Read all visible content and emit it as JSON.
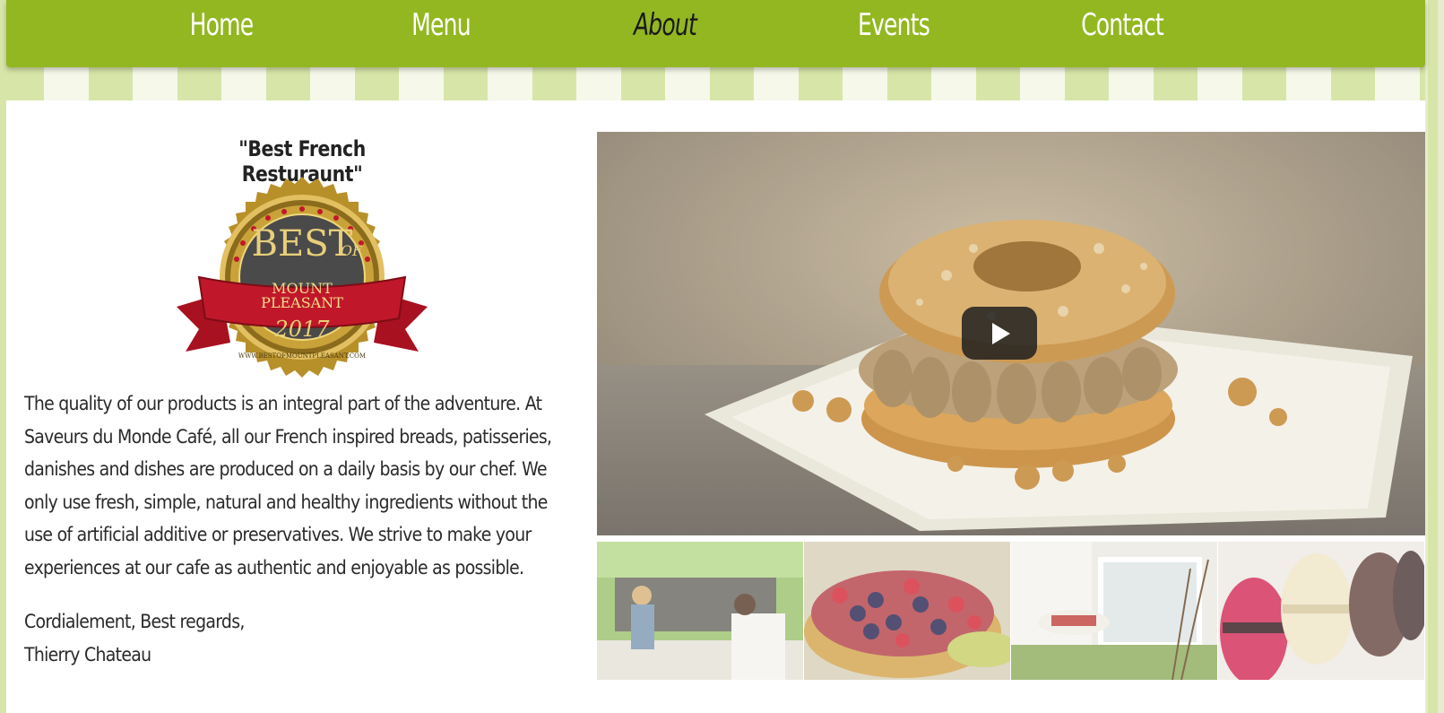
{
  "nav": {
    "items": [
      {
        "label": "Home"
      },
      {
        "label": "Menu"
      },
      {
        "label": "About"
      },
      {
        "label": "Events"
      },
      {
        "label": "Contact"
      }
    ],
    "active": "About"
  },
  "award": {
    "title": "\"Best French Resturaunt\"",
    "badge": {
      "line1": "BEST",
      "line1b": "OF",
      "line2": "MOUNT",
      "line3": "PLEASANT",
      "year": "2017",
      "url": "WWW.BESTOFMOUNTPLEASANT.COM"
    }
  },
  "about": {
    "paragraph": "The quality of our products is an integral part of the adventure. At Saveurs du Monde Café, all our French inspired breads, patisseries, danishes and dishes are produced on a daily basis by our chef. We only use fresh, simple, natural and healthy ingredients without the use of artificial additive or preservatives. We strive to make your experiences at our cafe as authentic and enjoyable as possible.",
    "signoff": "Cordialement, Best regards,",
    "signature": "Thierry Chateau"
  },
  "video": {
    "subject": "paris-brest-pastry",
    "icon": "play-icon"
  },
  "thumbnails": [
    {
      "subject": "cafe-counter"
    },
    {
      "subject": "berry-tart"
    },
    {
      "subject": "cafe-window-table"
    },
    {
      "subject": "macarons"
    }
  ],
  "colors": {
    "nav_green": "#93b721",
    "stripe_light": "#d7e6a8",
    "stripe_white": "#f6f8ea",
    "badge_gold": "#c9a23a",
    "badge_red": "#c0182a"
  }
}
